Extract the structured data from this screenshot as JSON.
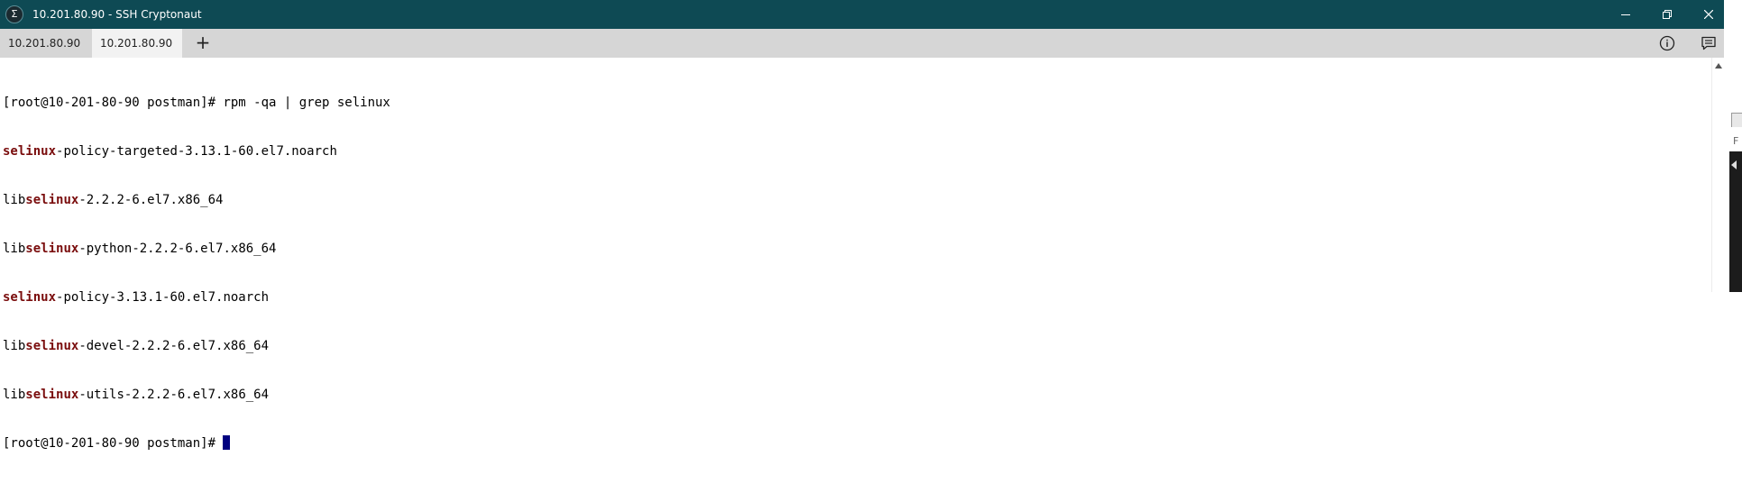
{
  "window": {
    "title": "10.201.80.90 - SSH Cryptonaut",
    "app_icon_glyph": "Σ",
    "controls": {
      "minimize_icon": "minimize-icon",
      "restore_icon": "restore-icon",
      "close_icon": "close-icon"
    },
    "title_bar_color": "#0e4a54"
  },
  "tabs": [
    {
      "label": "10.201.80.90",
      "active": false
    },
    {
      "label": "10.201.80.90",
      "active": true
    }
  ],
  "tab_add_label": "+",
  "toolbar": {
    "info_icon": "info-icon",
    "chat_icon": "message-icon"
  },
  "terminal": {
    "lines": [
      {
        "pre": "[root@10-201-80-90 postman]# rpm -qa | grep selinux",
        "match": "",
        "post": ""
      },
      {
        "pre": "",
        "match": "selinux",
        "post": "-policy-targeted-3.13.1-60.el7.noarch"
      },
      {
        "pre": "lib",
        "match": "selinux",
        "post": "-2.2.2-6.el7.x86_64"
      },
      {
        "pre": "lib",
        "match": "selinux",
        "post": "-python-2.2.2-6.el7.x86_64"
      },
      {
        "pre": "",
        "match": "selinux",
        "post": "-policy-3.13.1-60.el7.noarch"
      },
      {
        "pre": "lib",
        "match": "selinux",
        "post": "-devel-2.2.2-6.el7.x86_64"
      },
      {
        "pre": "lib",
        "match": "selinux",
        "post": "-utils-2.2.2-6.el7.x86_64"
      },
      {
        "pre": "[root@10-201-80-90 postman]# ",
        "match": "",
        "post": ""
      }
    ],
    "highlight_color": "#7a0d0d",
    "cursor_color": "#000080"
  },
  "edge_partial_letter": "F"
}
